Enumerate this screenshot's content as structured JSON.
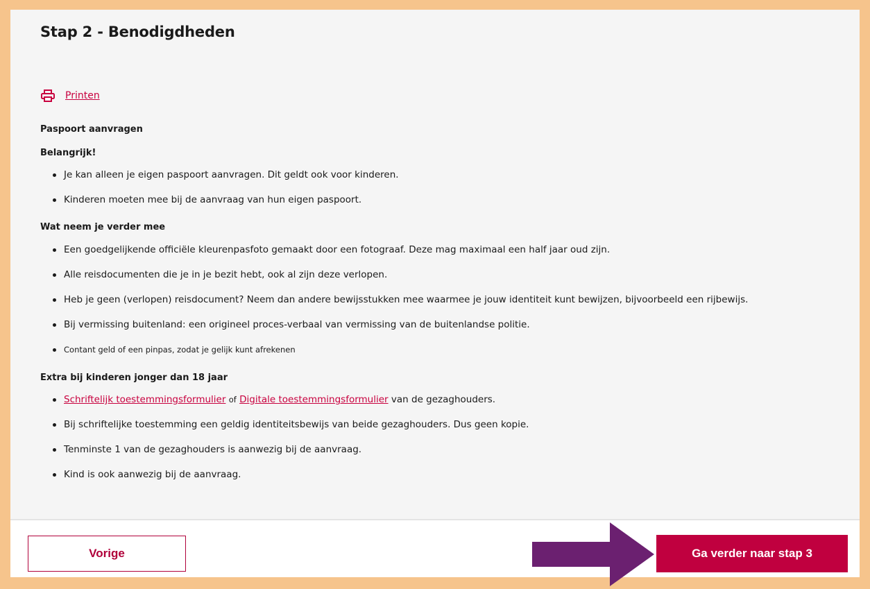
{
  "title": "Stap 2 - Benodigdheden",
  "print_label": "Printen",
  "section_heading": "Paspoort aanvragen",
  "important": {
    "heading": "Belangrijk!",
    "items": [
      "Je kan alleen je eigen paspoort aanvragen. Dit geldt ook voor kinderen.",
      "Kinderen moeten mee bij de aanvraag van hun eigen paspoort."
    ]
  },
  "bring": {
    "heading": "Wat neem je verder mee",
    "items": [
      "Een goedgelijkende officiële kleurenpasfoto gemaakt door een fotograaf. Deze mag maximaal een half jaar oud zijn.",
      "Alle reisdocumenten die je in je bezit hebt, ook al zijn deze verlopen.",
      "Heb je geen (verlopen) reisdocument? Neem dan andere bewijsstukken mee waarmee je jouw identiteit kunt bewijzen, bijvoorbeeld een rijbewijs.",
      "Bij vermissing buitenland: een origineel proces-verbaal van vermissing van de buitenlandse politie.",
      "Contant geld of een pinpas, zodat je gelijk kunt afrekenen"
    ]
  },
  "children": {
    "heading": "Extra bij kinderen jonger dan 18 jaar",
    "first_item": {
      "link1": "Schriftelijk toestemmingsformulier",
      "of": "of",
      "link2": "Digitale toestemmingsformulier",
      "suffix": "van de gezaghouders."
    },
    "items": [
      "Bij schriftelijke toestemming een geldig identiteitsbewijs van beide gezaghouders. Dus geen kopie.",
      "Tenminste 1 van de gezaghouders is aanwezig bij de aanvraag.",
      "Kind is ook aanwezig bij de aanvraag."
    ]
  },
  "footer": {
    "prev_label": "Vorige",
    "next_label": "Ga verder naar stap 3"
  },
  "colors": {
    "accent": "#c0003f",
    "frame": "#f6c48c",
    "arrow": "#6b2070"
  },
  "icons": {
    "print": "printer-icon",
    "arrow": "arrow-right-icon"
  }
}
